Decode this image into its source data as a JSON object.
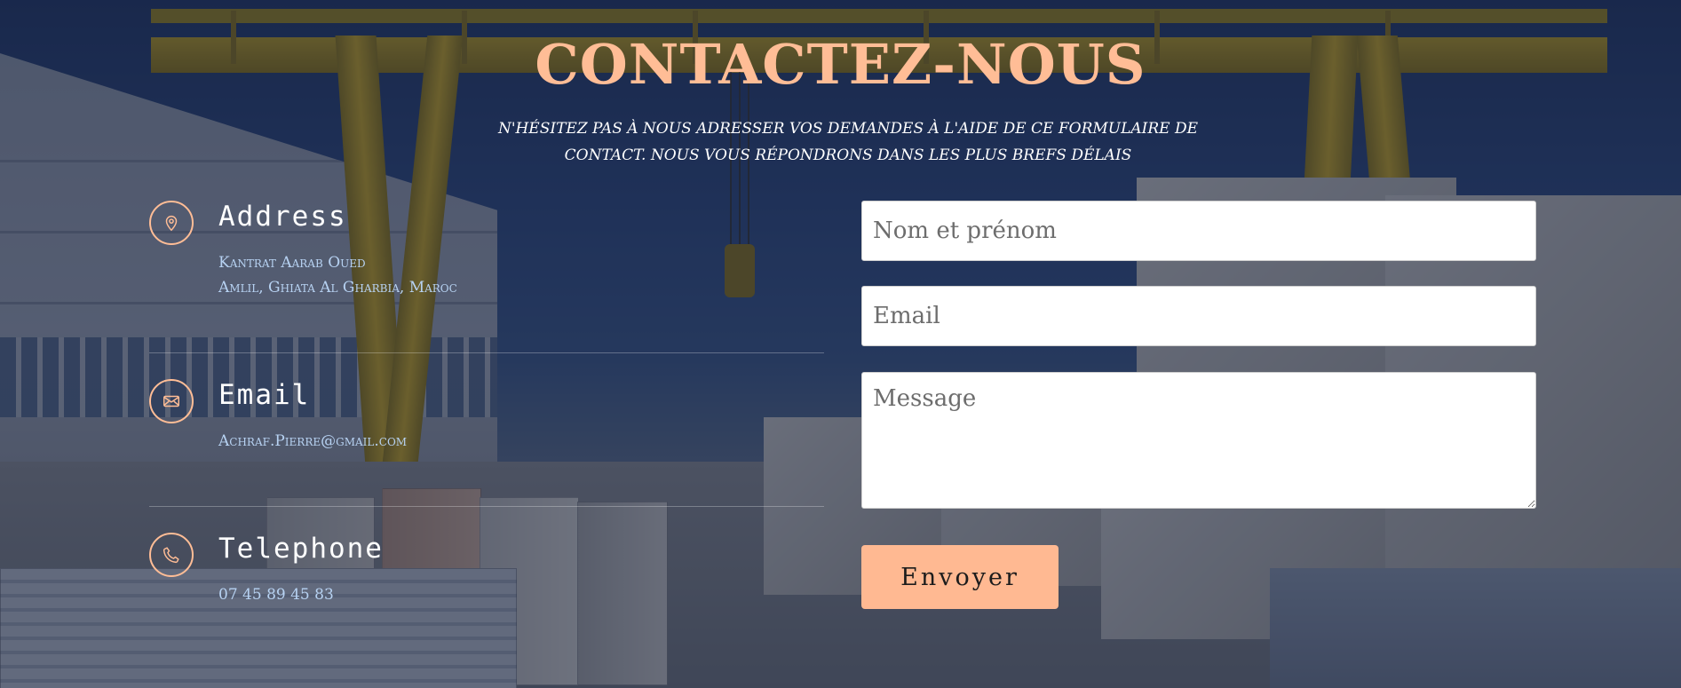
{
  "page": {
    "title": "CONTACTEZ-NOUS",
    "subtitle": "N'hésitez pas à nous adresser vos demandes à l'aide de ce formulaire de contact. Nous vous répondrons dans les plus brefs délais"
  },
  "contact_info": {
    "address": {
      "title": "Address",
      "icon": "location-pin-icon",
      "line1": "Kantrat Aarab Oued",
      "line2": "Amlil, Ghiata Al Gharbia, Maroc"
    },
    "email": {
      "title": "Email",
      "icon": "envelope-icon",
      "value": "Achraf.Pierre@gmail.com"
    },
    "telephone": {
      "title": "Telephone",
      "icon": "phone-icon",
      "value": "07 45 89 45 83"
    }
  },
  "form": {
    "name_placeholder": "Nom et prénom",
    "email_placeholder": "Email",
    "message_placeholder": "Message",
    "submit_label": "Envoyer"
  },
  "colors": {
    "accent": "#ffbd96",
    "button": "#ffb992",
    "info_text": "#b7d2f2",
    "overlay": "#1e2b55"
  }
}
